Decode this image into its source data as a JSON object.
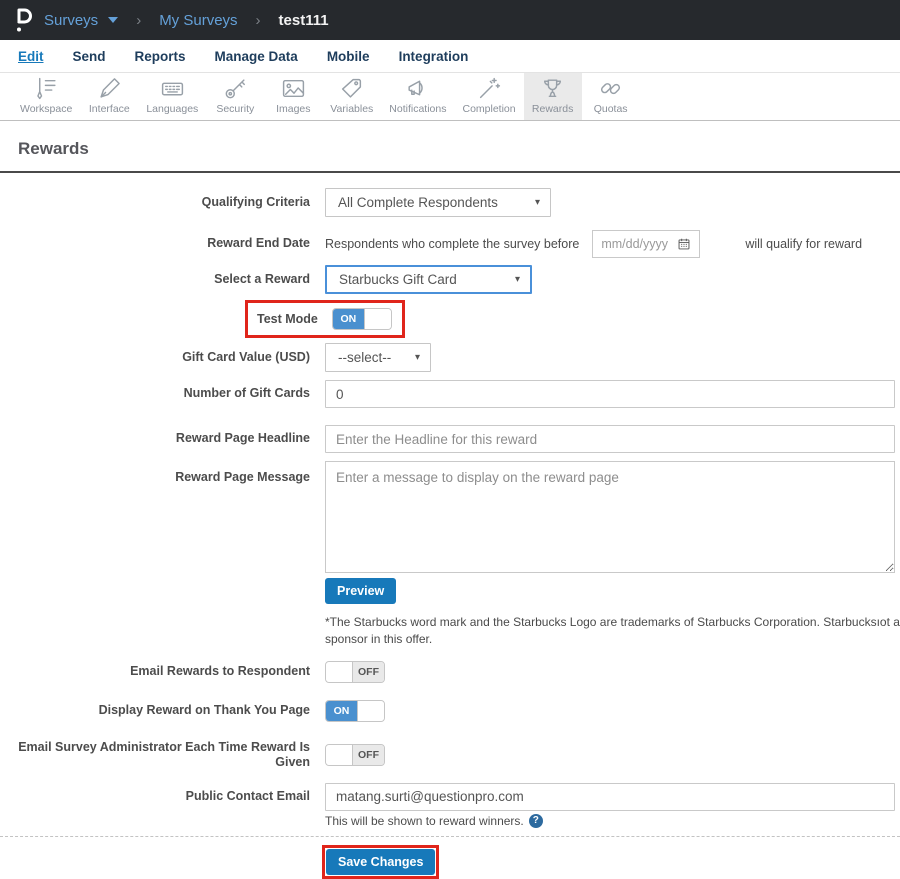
{
  "icons": {
    "dropdown_caret": "▾",
    "breadcrumb_sep": "›",
    "help": "?"
  },
  "colors": {
    "accent_blue": "#1779ba",
    "toggle_blue": "#4a90cf",
    "highlight_red": "#e0251b",
    "breadcrumb_blue": "#64a0d8",
    "topbar_bg": "#26292d"
  },
  "topbar": {
    "breadcrumb": [
      {
        "label": "Surveys"
      },
      {
        "label": "My Surveys"
      },
      {
        "label": "test111"
      }
    ]
  },
  "tabs": {
    "items": [
      {
        "label": "Edit",
        "active": true
      },
      {
        "label": "Send",
        "active": false
      },
      {
        "label": "Reports",
        "active": false
      },
      {
        "label": "Manage Data",
        "active": false
      },
      {
        "label": "Mobile",
        "active": false
      },
      {
        "label": "Integration",
        "active": false
      }
    ]
  },
  "toolbar": {
    "items": [
      {
        "label": "Workspace",
        "icon": "workspace-icon",
        "active": false
      },
      {
        "label": "Interface",
        "icon": "interface-icon",
        "active": false
      },
      {
        "label": "Languages",
        "icon": "languages-icon",
        "active": false
      },
      {
        "label": "Security",
        "icon": "security-icon",
        "active": false
      },
      {
        "label": "Images",
        "icon": "images-icon",
        "active": false
      },
      {
        "label": "Variables",
        "icon": "variables-icon",
        "active": false
      },
      {
        "label": "Notifications",
        "icon": "notifications-icon",
        "active": false
      },
      {
        "label": "Completion",
        "icon": "completion-icon",
        "active": false
      },
      {
        "label": "Rewards",
        "icon": "rewards-icon",
        "active": true
      },
      {
        "label": "Quotas",
        "icon": "quotas-icon",
        "active": false
      }
    ]
  },
  "page": {
    "title": "Rewards"
  },
  "form": {
    "qualifying_criteria": {
      "label": "Qualifying Criteria",
      "value": "All Complete Respondents"
    },
    "reward_end_date": {
      "label": "Reward End Date",
      "prefix": "Respondents who complete the survey before",
      "placeholder": "mm/dd/yyyy",
      "suffix": "will qualify for reward"
    },
    "select_reward": {
      "label": "Select a Reward",
      "value": "Starbucks Gift Card"
    },
    "test_mode": {
      "label": "Test Mode",
      "state": "ON"
    },
    "gift_card_value": {
      "label": "Gift Card Value (USD)",
      "value": "--select--"
    },
    "num_gift_cards": {
      "label": "Number of Gift Cards",
      "value": "0"
    },
    "headline": {
      "label": "Reward Page Headline",
      "placeholder": "Enter the Headline for this reward"
    },
    "message": {
      "label": "Reward Page Message",
      "placeholder": "Enter a message to display on the reward page"
    },
    "preview_label": "Preview",
    "disclaimer": "*The Starbucks word mark and the Starbucks Logo are trademarks of Starbucks Corporation. Starbucksıot a sponsor in this offer.",
    "email_rewards": {
      "label": "Email Rewards to Respondent",
      "state": "OFF"
    },
    "display_reward": {
      "label": "Display Reward on Thank You Page",
      "state": "ON"
    },
    "email_admin": {
      "label": "Email Survey Administrator Each Time Reward Is Given",
      "state": "OFF"
    },
    "public_email": {
      "label": "Public Contact Email",
      "value": "matang.surti@questionpro.com",
      "helper": "This will be shown to reward winners."
    },
    "save_label": "Save Changes"
  }
}
